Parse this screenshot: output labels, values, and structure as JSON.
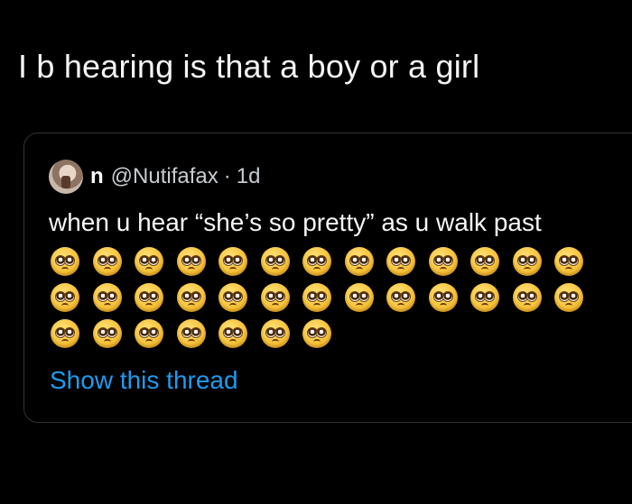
{
  "tweet": {
    "text": "I b hearing is that a boy or a girl"
  },
  "quoted_tweet": {
    "display_name": "n",
    "handle": "@Nutifafax",
    "separator": "·",
    "age": "1d",
    "text": "when u hear “she’s so pretty” as u walk past",
    "emoji_name": "pleading-face",
    "emoji_rows": [
      13,
      13,
      7
    ],
    "show_thread": "Show this thread"
  }
}
